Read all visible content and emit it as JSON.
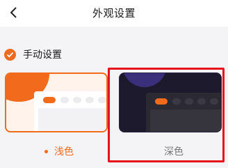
{
  "header": {
    "title": "外观设置",
    "back_icon": "chevron-left-icon"
  },
  "section": {
    "label": "手动设置",
    "checked": true,
    "check_icon": "checkmark-icon"
  },
  "themes": [
    {
      "id": "light",
      "label": "浅色",
      "selected": true
    },
    {
      "id": "dark",
      "label": "深色",
      "selected": false
    }
  ],
  "colors": {
    "accent": "#f26a1b",
    "highlight_box": "#e6111b",
    "dark_theme_bg": "#1e1a2e"
  }
}
